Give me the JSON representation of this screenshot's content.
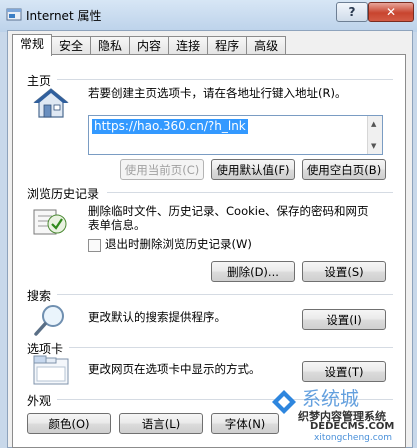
{
  "window": {
    "title": "Internet 属性",
    "help_label": "?",
    "close_label": "✕"
  },
  "tabs": [
    {
      "label": "常规",
      "active": true
    },
    {
      "label": "安全"
    },
    {
      "label": "隐私"
    },
    {
      "label": "内容"
    },
    {
      "label": "连接"
    },
    {
      "label": "程序"
    },
    {
      "label": "高级"
    }
  ],
  "homepage": {
    "title": "主页",
    "desc": "若要创建主页选项卡，请在各地址行键入地址(R)。",
    "url": "https://hao.360.cn/?h_lnk",
    "buttons": [
      "使用当前页(C)",
      "使用默认值(F)",
      "使用空白页(B)"
    ]
  },
  "history": {
    "title": "浏览历史记录",
    "desc_line1": "删除临时文件、历史记录、Cookie、保存的密码和网页",
    "desc_line2": "表单信息。",
    "checkbox_label": "退出时删除浏览历史记录(W)",
    "delete_label": "删除(D)...",
    "settings_label": "设置(S)"
  },
  "search": {
    "title": "搜索",
    "desc": "更改默认的搜索提供程序。",
    "settings_label": "设置(I)"
  },
  "tabs_section": {
    "title": "选项卡",
    "desc": "更改网页在选项卡中显示的方式。",
    "settings_label": "设置(T)"
  },
  "appearance": {
    "title": "外观",
    "buttons": [
      "颜色(O)",
      "语言(L)",
      "字体(N)"
    ]
  },
  "watermark": {
    "line1": "系统城",
    "line2": "织梦内容管理系统",
    "line3": "DEDECMS.COM",
    "line4": "xitongcheng.com"
  }
}
